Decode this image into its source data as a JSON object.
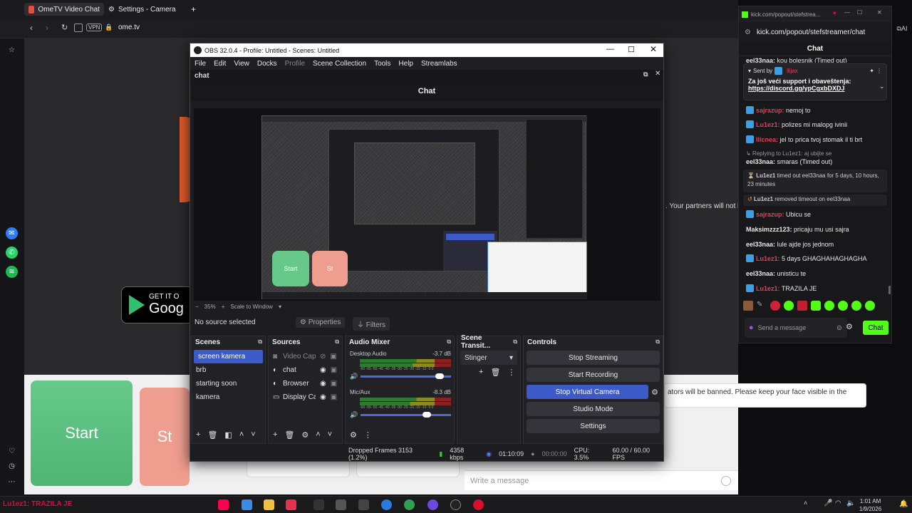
{
  "browser": {
    "tabs": [
      {
        "label": "OmeTV Video Chat — Or",
        "active": true
      },
      {
        "label": "Settings - Camera",
        "active": false
      }
    ],
    "new_tab": "+",
    "vpn": "VPN",
    "url": "ome.tv"
  },
  "page": {
    "partners_text": ". Your partners will not b",
    "warning_text": "ators will be banned. Please keep your face visible in the",
    "message_placeholder": "Write a message",
    "start_label": "Start",
    "stop_label": "St",
    "store_get": "GET IT O",
    "store_name": "Goog"
  },
  "obs": {
    "title": "OBS 32.0.4 - Profile: Untitled - Scenes: Untitled",
    "menu": [
      "File",
      "Edit",
      "View",
      "Docks",
      "Profile",
      "Scene Collection",
      "Tools",
      "Help",
      "Streamlabs"
    ],
    "dock_name": "chat",
    "chat_header": "Chat",
    "zoom": "35%",
    "scale_mode": "Scale to Window",
    "no_source": "No source selected",
    "properties": "Properties",
    "filters": "Filters",
    "preview": {
      "start": "Start",
      "stop": "St"
    },
    "scenes": {
      "title": "Scenes",
      "items": [
        "screen kamera",
        "brb",
        "starting soon",
        "kamera"
      ]
    },
    "sources": {
      "title": "Sources",
      "items": [
        "Video Capt",
        "chat",
        "Browser",
        "Display Cap"
      ]
    },
    "mixer": {
      "title": "Audio Mixer",
      "channels": [
        {
          "name": "Desktop Audio",
          "db": "-3.7 dB",
          "volume": 0.92
        },
        {
          "name": "Mic/Aux",
          "db": "-8.3 dB",
          "volume": 0.78
        }
      ],
      "scale": "-60 -55 -50 -45 -40 -35 -30 -25 -20 -15 -10 -5 0"
    },
    "transitions": {
      "title": "Scene Transit...",
      "selected": "Stinger"
    },
    "controls": {
      "title": "Controls",
      "buttons": [
        "Stop Streaming",
        "Start Recording",
        "Stop Virtual Camera",
        "Studio Mode",
        "Settings"
      ]
    },
    "status": {
      "dropped": "Dropped Frames 3153 (1.2%)",
      "bitrate": "4358 kbps",
      "stream_time": "01:10:09",
      "rec_time": "00:00:00",
      "cpu": "CPU: 3.5%",
      "fps": "60.00 / 60.00 FPS"
    }
  },
  "kick": {
    "url_short": "kick.com/popout/stefstrea...",
    "url": "kick.com/popout/stefstreamer/chat",
    "title": "Chat",
    "pinned": {
      "sent_by": "Sent by",
      "sender": "llijax",
      "text": "Za još veći support i obaveštenja:",
      "link": "https://discord.gg/ypCgxbDXDJ"
    },
    "top_line": {
      "user": "eel33naa:",
      "text": "kou bolesnik (Timed out)"
    },
    "messages": [
      {
        "user": "sajrazup:",
        "text": "nemoj to",
        "color": "#e0405a"
      },
      {
        "user": "Lu1ez1:",
        "text": "polizes mi malopg ivinii",
        "color": "#e0405a"
      },
      {
        "user": "llicnea:",
        "text": "jel to prica tvoj stomak il ti brt",
        "color": "#e0405a"
      },
      {
        "user": "Replying to Lu1ez1:",
        "text": "aj ubijte se",
        "color": "#9a9a9a"
      },
      {
        "user": "eel33naa:",
        "text": "smaras (Timed out)",
        "color": "#ffffff"
      },
      {
        "user": "Lu1ez1",
        "text": "timed out eel33naa for 5 days, 10 hours, 23 minutes",
        "color": "#cfcfcf"
      },
      {
        "user": "Lu1ez1",
        "text": "removed timeout on eel33naa",
        "color": "#cfcfcf"
      },
      {
        "user": "sajrazup:",
        "text": "Ubicu se",
        "color": "#e0405a"
      },
      {
        "user": "Maksimzzz123:",
        "text": "pricaju mu usi sajra",
        "color": "#ffffff"
      },
      {
        "user": "eel33naa:",
        "text": "lule ajde jos jednom",
        "color": "#ffffff"
      },
      {
        "user": "Lu1ez1:",
        "text": "5 days GHAGHAHAGHAGHA",
        "color": "#e0405a"
      },
      {
        "user": "eel33naa:",
        "text": "unisticu te",
        "color": "#ffffff"
      },
      {
        "user": "Lu1ez1:",
        "text": "TRAZILA JE",
        "color": "#e0405a"
      }
    ],
    "send_placeholder": "Send a message",
    "chat_button": "Chat"
  },
  "taskbar": {
    "notification": "Lu1ez1: TRAZILA JE",
    "time": "1:01 AM",
    "date": "1/9/2026"
  },
  "colors": {
    "accent": "#3c5ac8",
    "kick_green": "#53fc18"
  }
}
